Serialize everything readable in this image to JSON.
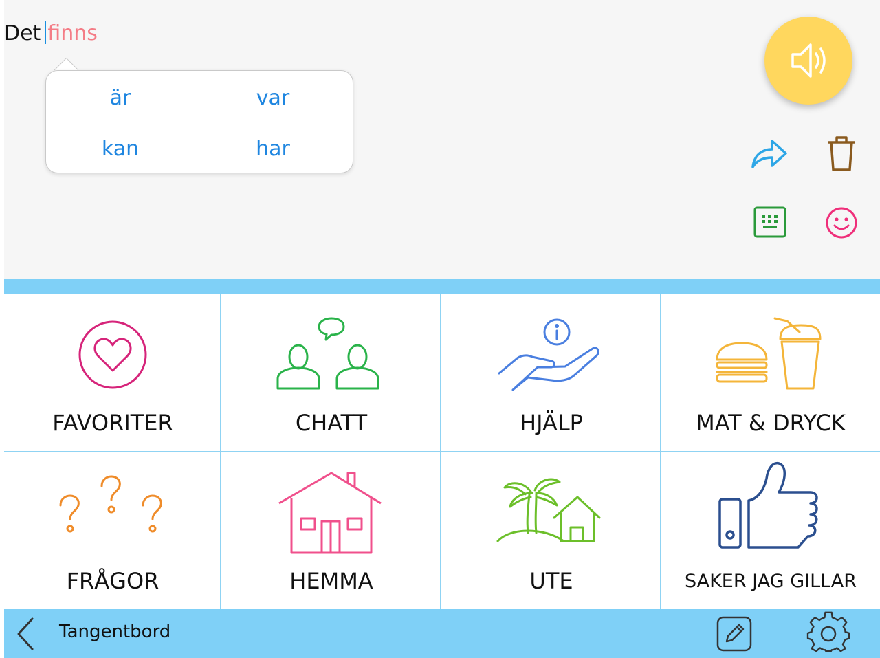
{
  "message": {
    "typed_text": "Det",
    "predicted_text": "finns"
  },
  "suggestions": [
    "är",
    "var",
    "kan",
    "har"
  ],
  "actions": {
    "speak_icon": "speaker-icon",
    "share_icon": "share-arrow-icon",
    "delete_icon": "trash-icon",
    "keyboard_icon": "keyboard-icon",
    "emoji_icon": "smiley-icon"
  },
  "categories": [
    {
      "label": "FAVORITER",
      "icon": "heart-icon",
      "color": "#d6247a"
    },
    {
      "label": "CHATT",
      "icon": "chat-people-icon",
      "color": "#2ab34a"
    },
    {
      "label": "HJÄLP",
      "icon": "help-hand-icon",
      "color": "#4a7fe0"
    },
    {
      "label": "MAT & DRYCK",
      "icon": "food-drink-icon",
      "color": "#f4b53a"
    },
    {
      "label": "FRÅGOR",
      "icon": "question-marks-icon",
      "color": "#ef8c2a"
    },
    {
      "label": "HEMMA",
      "icon": "house-icon",
      "color": "#f0508c"
    },
    {
      "label": "UTE",
      "icon": "island-icon",
      "color": "#6cbf2a"
    },
    {
      "label": "SAKER JAG GILLAR",
      "icon": "thumbs-up-icon",
      "color": "#2b4f8f"
    }
  ],
  "bottom_bar": {
    "back_icon": "chevron-left-icon",
    "label": "Tangentbord",
    "edit_icon": "pencil-icon",
    "settings_icon": "gear-icon"
  },
  "colors": {
    "accent": "#7fd0f7",
    "speak": "#ffd75e",
    "suggestion": "#1f86e0",
    "prediction": "#f47c86"
  }
}
